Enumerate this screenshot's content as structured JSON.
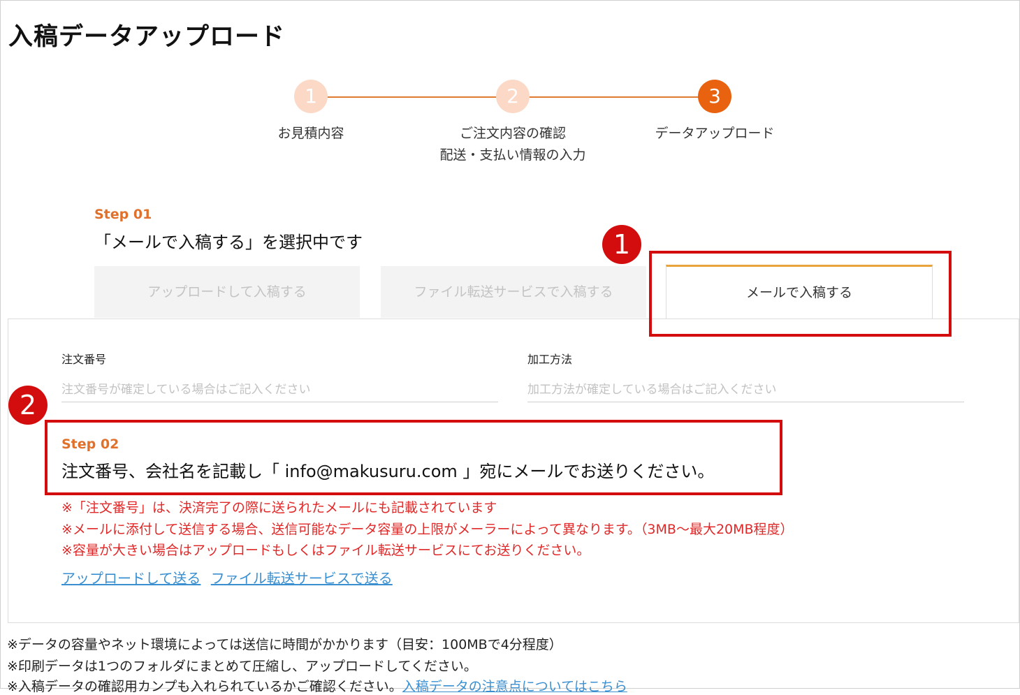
{
  "page": {
    "title": "入稿データアップロード"
  },
  "stepper": {
    "steps": [
      {
        "number": "1",
        "label_line1": "お見積内容",
        "label_line2": ""
      },
      {
        "number": "2",
        "label_line1": "ご注文内容の確認",
        "label_line2": "配送・支払い情報の入力"
      },
      {
        "number": "3",
        "label_line1": "データアップロード",
        "label_line2": ""
      }
    ],
    "active_step": 3
  },
  "step01": {
    "label": "Step 01",
    "heading": "「メールで入稿する」を選択中です"
  },
  "tabs": [
    {
      "label": "アップロードして入稿する",
      "active": false
    },
    {
      "label": "ファイル転送サービスで入稿する",
      "active": false
    },
    {
      "label": "メールで入稿する",
      "active": true
    }
  ],
  "form": {
    "order_number": {
      "label": "注文番号",
      "placeholder": "注文番号が確定している場合はご記入ください",
      "value": ""
    },
    "processing": {
      "label": "加工方法",
      "placeholder": "加工方法が確定している場合はご記入ください",
      "value": ""
    }
  },
  "step02": {
    "label": "Step 02",
    "instruction": "注文番号、会社名を記載し「 info@makusuru.com 」宛にメールでお送りください。"
  },
  "notes": [
    "※「注文番号」は、決済完了の際に送られたメールにも記載されています",
    "※メールに添付して送信する場合、送信可能なデータ容量の上限がメーラーによって異なります。（3MB〜最大20MB程度）",
    "※容量が大きい場合はアップロードもしくはファイル転送サービスにてお送りください。"
  ],
  "links": {
    "upload": "アップロードして送る",
    "transfer": "ファイル転送サービスで送る"
  },
  "footer": {
    "note1": "※データの容量やネット環境によっては送信に時間がかかります（目安：100MBで4分程度）",
    "note2": "※印刷データは1つのフォルダにまとめて圧縮し、アップロードしてください。",
    "note3": "※入稿データの確認用カンプも入れられているかご確認ください。",
    "note3_link": "入稿データの注意点についてはこちら"
  },
  "annotations": {
    "badge1": "1",
    "badge2": "2"
  },
  "colors": {
    "accent": "#e8620f",
    "step_inactive": "#fbd9c6",
    "annotation_red": "#d30d0d",
    "note_red": "#e02828",
    "link": "#3a8fd0"
  }
}
